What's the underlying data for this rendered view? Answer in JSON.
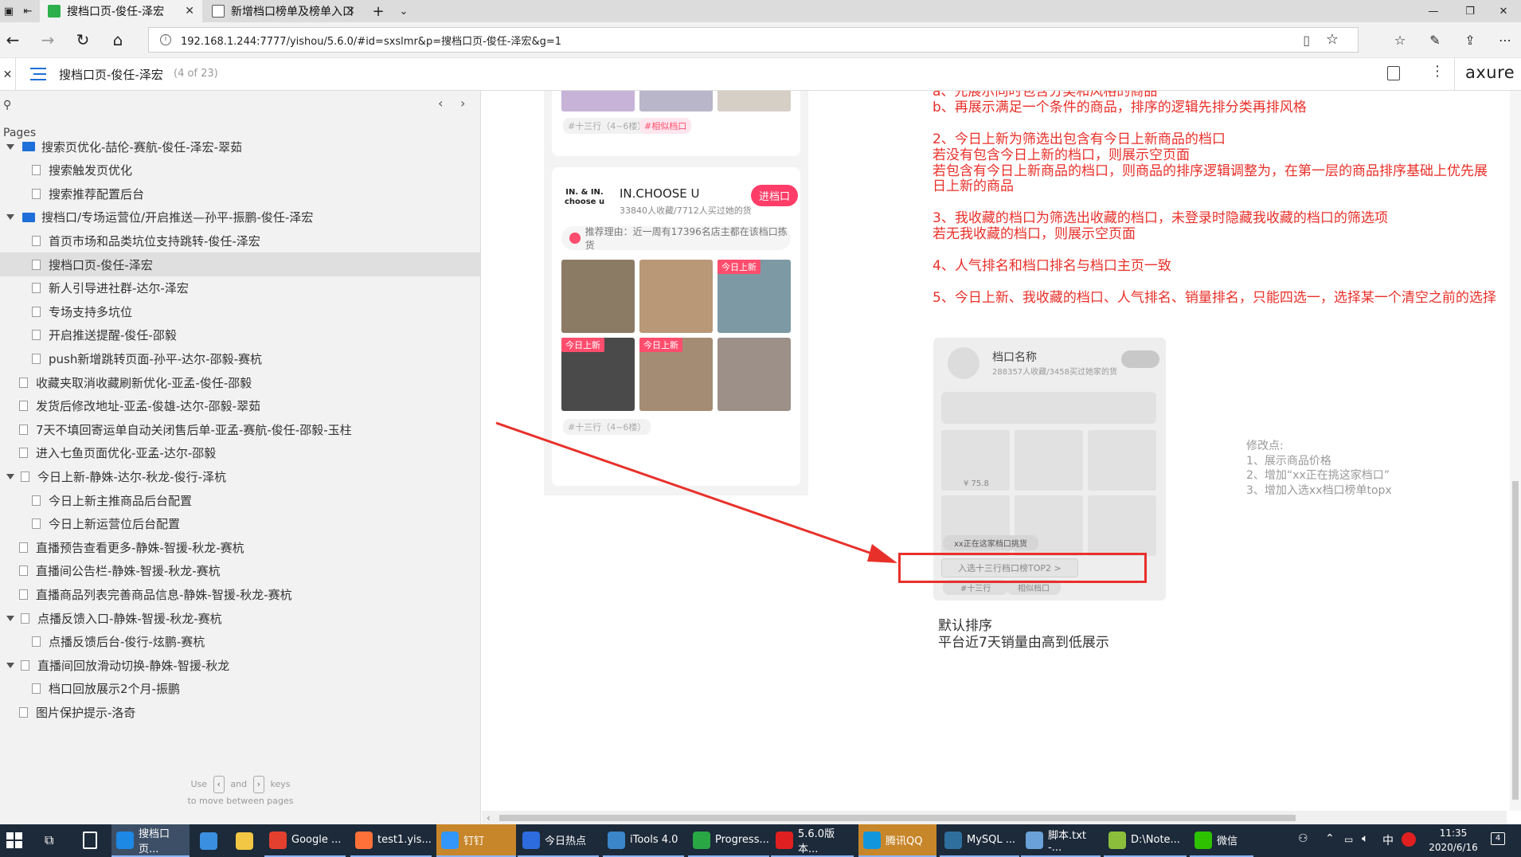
{
  "browser": {
    "tabs": [
      {
        "title": "搜档口页-俊任-泽宏",
        "active": true
      },
      {
        "title": "新增档口榜单及榜单入口",
        "active": false
      }
    ],
    "url": "192.168.1.244:7777/yishou/5.6.0/#id=sxslmr&p=搜档口页-俊任-泽宏&g=1"
  },
  "axure": {
    "page_title": "搜档口页-俊任-泽宏",
    "page_count": "(4 of 23)",
    "logo": "axure",
    "search_placeholder": ""
  },
  "sidebar": {
    "section_label": "Pages",
    "items": [
      {
        "label": "搜索页优化-喆伦-赛航-俊任-泽宏-翠茹",
        "type": "folder",
        "level": 0,
        "expanded": true
      },
      {
        "label": "搜索触发页优化",
        "type": "page",
        "level": 1
      },
      {
        "label": "搜索推荐配置后台",
        "type": "page",
        "level": 1
      },
      {
        "label": "搜档口/专场运营位/开启推送—孙平-振鹏-俊任-泽宏",
        "type": "folder",
        "level": 0,
        "expanded": true
      },
      {
        "label": "首页市场和品类坑位支持跳转-俊任-泽宏",
        "type": "page",
        "level": 1
      },
      {
        "label": "搜档口页-俊任-泽宏",
        "type": "page",
        "level": 1,
        "selected": true
      },
      {
        "label": "新人引导进社群-达尔-泽宏",
        "type": "page",
        "level": 1
      },
      {
        "label": "专场支持多坑位",
        "type": "page",
        "level": 1
      },
      {
        "label": "开启推送提醒-俊任-邵毅",
        "type": "page",
        "level": 1
      },
      {
        "label": "push新增跳转页面-孙平-达尔-邵毅-赛杭",
        "type": "page",
        "level": 1
      },
      {
        "label": "收藏夹取消收藏刷新优化-亚孟-俊任-邵毅",
        "type": "page",
        "level": 0
      },
      {
        "label": "发货后修改地址-亚孟-俊雄-达尔-邵毅-翠茹",
        "type": "page",
        "level": 0
      },
      {
        "label": "7天不填回寄运单自动关闭售后单-亚孟-赛航-俊任-邵毅-玉柱",
        "type": "page",
        "level": 0
      },
      {
        "label": "进入七鱼页面优化-亚孟-达尔-邵毅",
        "type": "page",
        "level": 0
      },
      {
        "label": "今日上新-静姝-达尔-秋龙-俊行-泽杭",
        "type": "caret",
        "level": 0,
        "expanded": true
      },
      {
        "label": "今日上新主推商品后台配置",
        "type": "page",
        "level": 1
      },
      {
        "label": "今日上新运营位后台配置",
        "type": "page",
        "level": 1
      },
      {
        "label": "直播预告查看更多-静姝-智援-秋龙-赛杭",
        "type": "page",
        "level": 0
      },
      {
        "label": "直播间公告栏-静姝-智援-秋龙-赛杭",
        "type": "page",
        "level": 0
      },
      {
        "label": "直播商品列表完善商品信息-静姝-智援-秋龙-赛杭",
        "type": "page",
        "level": 0
      },
      {
        "label": "点播反馈入口-静姝-智援-秋龙-赛杭",
        "type": "caret",
        "level": 0,
        "expanded": true
      },
      {
        "label": "点播反馈后台-俊行-炫鹏-赛杭",
        "type": "page",
        "level": 1
      },
      {
        "label": "直播间回放滑动切换-静姝-智援-秋龙",
        "type": "caret",
        "level": 0,
        "expanded": true
      },
      {
        "label": "档口回放展示2个月-振鹏",
        "type": "page",
        "level": 1
      },
      {
        "label": "图片保护提示-洛奇",
        "type": "page",
        "level": 0
      }
    ],
    "hint_use": "Use",
    "hint_and": "and",
    "hint_keys": "keys",
    "hint_line2": "to move between pages"
  },
  "mock": {
    "top_tags": [
      "#十三行（4~6楼）",
      "#相似档口"
    ],
    "shop_logo_line1": "IN. & IN.",
    "shop_logo_line2": "choose u",
    "shop_name": "IN.CHOOSE U",
    "shop_stats": "33840人收藏/7712人买过她的货",
    "enter_button": "进档口",
    "reason": "推荐理由：近一周有17396名店主都在该档口拣货",
    "new_badge": "今日上新",
    "bottom_tag": "#十三行（4~6楼）"
  },
  "requirements": [
    "a、先展示同时包含分类和风格的商品",
    "b、再展示满足一个条件的商品，排序的逻辑先排分类再排风格",
    "",
    "2、今日上新为筛选出包含有今日上新商品的档口",
    "若没有包含今日上新的档口，则展示空页面",
    "若包含有今日上新商品的档口，则商品的排序逻辑调整为，在第一层的商品排序基础上优先展",
    "日上新的商品",
    "",
    "3、我收藏的档口为筛选出收藏的档口，未登录时隐藏我收藏的档口的筛选项",
    "若无我收藏的档口，则展示空页面",
    "",
    "4、人气排名和档口排名与档口主页一致",
    "",
    "5、今日上新、我收藏的档口、人气排名、销量排名，只能四选一，选择某一个清空之前的选择"
  ],
  "wireframe": {
    "shop_name": "档口名称",
    "shop_stats": "288357人收藏/3458买过她家的货",
    "price": "¥ 75.8",
    "picking": "xx正在这家档口挑货",
    "rank_entry": "入选十三行档口榜TOP2 >",
    "tag1": "#十三行",
    "tag2": "相似档口"
  },
  "changes": {
    "title": "修改点:",
    "items": [
      "1、展示商品价格",
      "2、增加“xx正在挑这家档口”",
      "3、增加入选xx档口榜单topx"
    ]
  },
  "sort": {
    "title": "默认排序",
    "desc": "平台近7天销量由高到低展示"
  },
  "taskbar": {
    "items": [
      {
        "label": "搜档口页...",
        "color": "#1e88e5",
        "active": true
      },
      {
        "label": "",
        "color": "#3b8fe0"
      },
      {
        "label": "",
        "color": "#f2c744"
      },
      {
        "label": "Google ...",
        "color": "#e4402f"
      },
      {
        "label": "test1.yis...",
        "color": "#ff7139"
      },
      {
        "label": "钉钉",
        "color": "#3296fa",
        "highlight": true
      },
      {
        "label": "今日热点",
        "color": "#2d6cdf"
      },
      {
        "label": "iTools 4.0",
        "color": "#3a86c8"
      },
      {
        "label": "Progress...",
        "color": "#29a745"
      },
      {
        "label": "5.6.0版本...",
        "color": "#e02020"
      },
      {
        "label": "腾讯QQ",
        "color": "#1296db",
        "highlight": true
      },
      {
        "label": "MySQL ...",
        "color": "#2f6f9e"
      },
      {
        "label": "脚本.txt -...",
        "color": "#6aa1d8"
      },
      {
        "label": "D:\\Note...",
        "color": "#8bbf3b"
      },
      {
        "label": "微信",
        "color": "#2dc100"
      }
    ],
    "ime": "中",
    "time": "11:35",
    "date": "2020/6/16",
    "notif": "4"
  },
  "colors": {
    "accent": "#e8302a",
    "brand_pink": "#ff4d6d",
    "axure_selected": "#dfdfdf"
  }
}
